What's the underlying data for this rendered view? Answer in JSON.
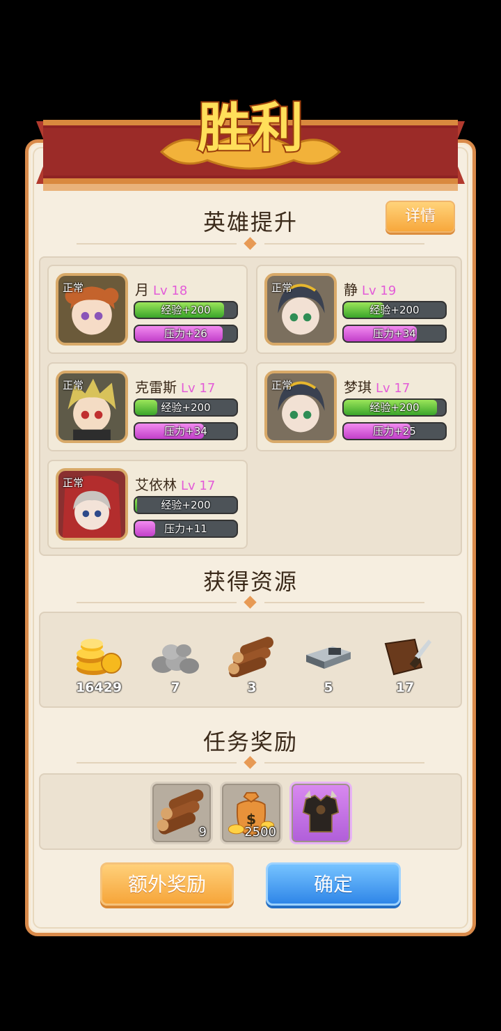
{
  "title": "胜利",
  "hero_section": {
    "title": "英雄提升",
    "detail_label": "详情",
    "heroes": [
      {
        "name": "月",
        "level": "Lv 18",
        "status": "正常",
        "exp_label": "经验+200",
        "exp_fill": 0.88,
        "stress_label": "压力+26",
        "stress_fill": 0.86
      },
      {
        "name": "静",
        "level": "Lv 19",
        "status": "正常",
        "exp_label": "经验+200",
        "exp_fill": 0.4,
        "stress_label": "压力+34",
        "stress_fill": 0.72
      },
      {
        "name": "克雷斯",
        "level": "Lv 17",
        "status": "正常",
        "exp_label": "经验+200",
        "exp_fill": 0.22,
        "stress_label": "压力+34",
        "stress_fill": 0.68
      },
      {
        "name": "梦琪",
        "level": "Lv 17",
        "status": "正常",
        "exp_label": "经验+200",
        "exp_fill": 0.92,
        "stress_label": "压力+25",
        "stress_fill": 0.66
      },
      {
        "name": "艾依林",
        "level": "Lv 17",
        "status": "正常",
        "exp_label": "经验+200",
        "exp_fill": 0.02,
        "stress_label": "压力+11",
        "stress_fill": 0.2
      }
    ]
  },
  "resources_section": {
    "title": "获得资源",
    "items": [
      {
        "icon": "gold-coins-icon",
        "count": "16429"
      },
      {
        "icon": "stone-icon",
        "count": "7"
      },
      {
        "icon": "wood-logs-icon",
        "count": "3"
      },
      {
        "icon": "iron-ingot-icon",
        "count": "5"
      },
      {
        "icon": "leather-icon",
        "count": "17"
      }
    ]
  },
  "quest_section": {
    "title": "任务奖励",
    "rewards": [
      {
        "icon": "wood-logs-icon",
        "count": "9",
        "rarity": "common"
      },
      {
        "icon": "money-bag-icon",
        "count": "2500",
        "rarity": "common"
      },
      {
        "icon": "dark-armor-icon",
        "count": "",
        "rarity": "epic"
      }
    ]
  },
  "buttons": {
    "extra_reward": "额外奖励",
    "confirm": "确定"
  },
  "colors": {
    "panel_border": "#d98a4a",
    "banner_red": "#9c2a2a",
    "level_pink": "#e35bd8",
    "exp_green": "#3aa52a",
    "stress_purple": "#c23fc9"
  }
}
